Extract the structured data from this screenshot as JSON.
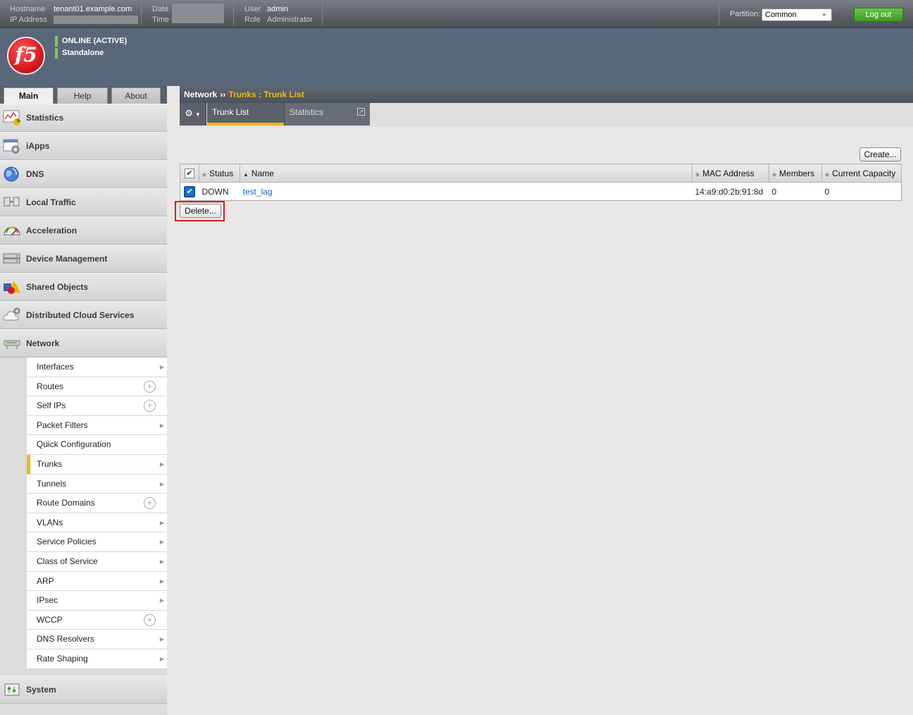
{
  "topbar": {
    "hostname_label": "Hostname",
    "hostname": "tenant01.example.com",
    "ip_label": "IP Address",
    "date_label": "Date",
    "time_label": "Time",
    "user_label": "User",
    "user": "admin",
    "role_label": "Role",
    "role": "Administrator",
    "partition_label": "Partition:",
    "partition_value": "Common",
    "logout_label": "Log out"
  },
  "banner": {
    "logo_text": "f5",
    "status": "ONLINE (ACTIVE)",
    "mode": "Standalone"
  },
  "navtabs": [
    "Main",
    "Help",
    "About"
  ],
  "sidebar": {
    "sections": [
      {
        "label": "Statistics",
        "icon": "statistics-icon"
      },
      {
        "label": "iApps",
        "icon": "iapps-icon"
      },
      {
        "label": "DNS",
        "icon": "globe-icon"
      },
      {
        "label": "Local Traffic",
        "icon": "local-traffic-icon"
      },
      {
        "label": "Acceleration",
        "icon": "gauge-icon"
      },
      {
        "label": "Device Management",
        "icon": "device-icon"
      },
      {
        "label": "Shared Objects",
        "icon": "shapes-icon"
      },
      {
        "label": "Distributed Cloud Services",
        "icon": "cloud-gear-icon"
      },
      {
        "label": "Network",
        "icon": "network-icon"
      }
    ],
    "network_items": [
      {
        "label": "Interfaces",
        "indicator": "arrow"
      },
      {
        "label": "Routes",
        "indicator": "plus"
      },
      {
        "label": "Self IPs",
        "indicator": "plus"
      },
      {
        "label": "Packet Filters",
        "indicator": "arrow"
      },
      {
        "label": "Quick Configuration",
        "indicator": "none"
      },
      {
        "label": "Trunks",
        "indicator": "arrow"
      },
      {
        "label": "Tunnels",
        "indicator": "arrow"
      },
      {
        "label": "Route Domains",
        "indicator": "plus"
      },
      {
        "label": "VLANs",
        "indicator": "arrow"
      },
      {
        "label": "Service Policies",
        "indicator": "arrow"
      },
      {
        "label": "Class of Service",
        "indicator": "arrow"
      },
      {
        "label": "ARP",
        "indicator": "arrow"
      },
      {
        "label": "IPsec",
        "indicator": "arrow"
      },
      {
        "label": "WCCP",
        "indicator": "plus"
      },
      {
        "label": "DNS Resolvers",
        "indicator": "arrow"
      },
      {
        "label": "Rate Shaping",
        "indicator": "arrow"
      }
    ],
    "active_item": "Trunks",
    "system_label": "System"
  },
  "breadcrumb": {
    "root": "Network",
    "separator": "››",
    "current": "Trunks : Trunk List"
  },
  "tabs": {
    "trunk_list": "Trunk List",
    "statistics": "Statistics"
  },
  "buttons": {
    "create": "Create...",
    "delete": "Delete..."
  },
  "table": {
    "columns": [
      "Status",
      "Name",
      "MAC Address",
      "Members",
      "Current Capacity"
    ],
    "rows": [
      {
        "checked": true,
        "status": "DOWN",
        "name": "test_lag",
        "mac": "14:a9:d0:2b:91:8d",
        "members": "0",
        "capacity": "0"
      }
    ]
  },
  "colors": {
    "accent": "#f3b600",
    "highlight": "#d71c23",
    "logout": "#4caf2a"
  }
}
